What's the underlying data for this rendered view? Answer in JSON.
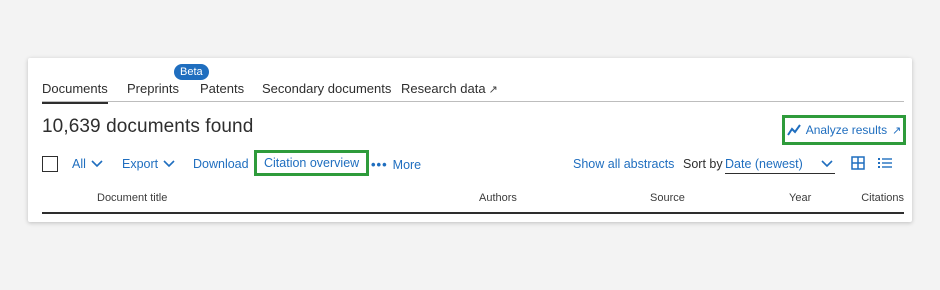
{
  "tabs": [
    {
      "label": "Documents",
      "active": true
    },
    {
      "label": "Preprints",
      "badge": "Beta"
    },
    {
      "label": "Patents"
    },
    {
      "label": "Secondary documents"
    },
    {
      "label": "Research data",
      "external_icon": "↗"
    }
  ],
  "results": {
    "count_text": "10,639 documents found",
    "analyze_label": "Analyze results",
    "analyze_external_icon": "↗"
  },
  "toolbar": {
    "all_label": "All",
    "export_label": "Export",
    "download_label": "Download",
    "citation_label": "Citation overview",
    "more_dots": "•••",
    "more_label": "More",
    "show_abstracts_label": "Show all abstracts",
    "sort_by_label": "Sort by",
    "sort_value": "Date (newest)"
  },
  "columns": [
    "Document title",
    "Authors",
    "Source",
    "Year",
    "Citations"
  ],
  "colors": {
    "link": "#1f6ebf",
    "highlight_border": "#2e9b3b",
    "badge_bg": "#1f6ebf"
  }
}
